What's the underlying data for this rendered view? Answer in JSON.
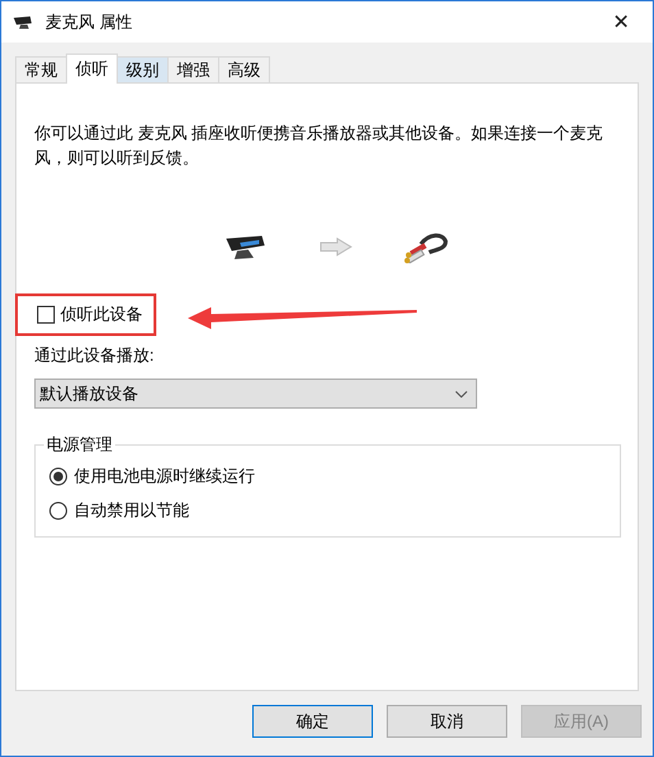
{
  "window": {
    "title": "麦克风 属性",
    "close": "✕"
  },
  "tabs": [
    {
      "label": "常规",
      "selected": false,
      "hovered": false
    },
    {
      "label": "侦听",
      "selected": true,
      "hovered": false
    },
    {
      "label": "级别",
      "selected": false,
      "hovered": true
    },
    {
      "label": "增强",
      "selected": false,
      "hovered": false
    },
    {
      "label": "高级",
      "selected": false,
      "hovered": false
    }
  ],
  "description": "你可以通过此 麦克风 插座收听便携音乐播放器或其他设备。如果连接一个麦克风，则可以听到反馈。",
  "listen_checkbox": {
    "label": "侦听此设备",
    "checked": false,
    "highlighted": true
  },
  "playback": {
    "label": "通过此设备播放:",
    "value": "默认播放设备"
  },
  "power": {
    "title": "电源管理",
    "options": [
      {
        "label": "使用电池电源时继续运行",
        "selected": true
      },
      {
        "label": "自动禁用以节能",
        "selected": false
      }
    ]
  },
  "buttons": [
    {
      "label": "确定",
      "focused": true,
      "disabled": false
    },
    {
      "label": "取消",
      "focused": false,
      "disabled": false
    },
    {
      "label": "应用(A)",
      "focused": false,
      "disabled": true
    }
  ]
}
